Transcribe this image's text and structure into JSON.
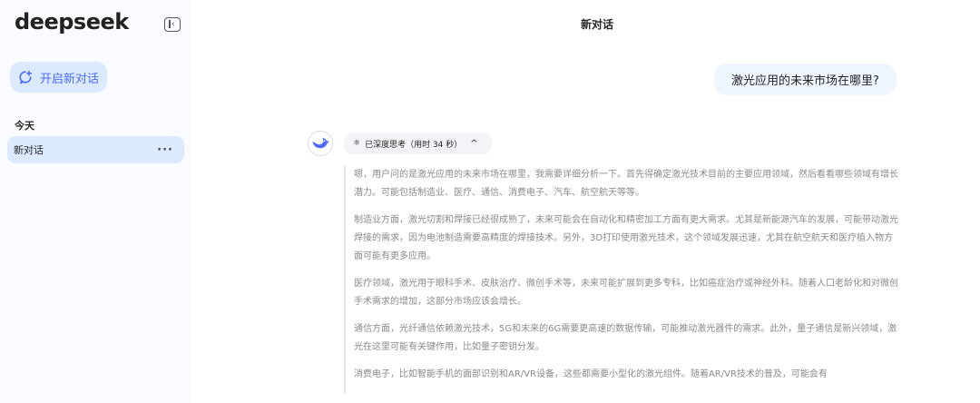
{
  "sidebar": {
    "logo": "deepseek",
    "new_chat_label": "开启新对话",
    "section_today": "今天",
    "history": [
      {
        "title": "新对话",
        "more": "···"
      }
    ]
  },
  "main": {
    "title": "新对话",
    "user_message": "激光应用的未来市场在哪里?",
    "thinking_toggle": {
      "icon": "atom-icon",
      "label": "已深度思考（用时 34 秒）",
      "chevron": "^"
    },
    "reasoning": [
      "嗯，用户问的是激光应用的未来市场在哪里，我需要详细分析一下。首先得确定激光技术目前的主要应用领域，然后看看哪些领域有增长潜力。可能包括制造业、医疗、通信、消费电子、汽车、航空航天等等。",
      "制造业方面，激光切割和焊接已经很成熟了，未来可能会在自动化和精密加工方面有更大需求。尤其是新能源汽车的发展，可能带动激光焊接的需求，因为电池制造需要高精度的焊接技术。另外，3D打印使用激光技术，这个领域发展迅速，尤其在航空航天和医疗植入物方面可能有更多应用。",
      "医疗领域，激光用于眼科手术、皮肤治疗、微创手术等，未来可能扩展到更多专科，比如癌症治疗或神经外科。随着人口老龄化和对微创手术需求的增加，这部分市场应该会增长。",
      "通信方面，光纤通信依赖激光技术，5G和未来的6G需要更高速的数据传输，可能推动激光器件的需求。此外，量子通信是新兴领域，激光在这里可能有关键作用，比如量子密钥分发。",
      "消费电子，比如智能手机的面部识别和AR/VR设备，这些都需要小型化的激光组件。随着AR/VR技术的普及，可能会有"
    ]
  },
  "colors": {
    "accent": "#4d6bfe",
    "sidebar_bg": "#f9fbff",
    "selected_bg": "#dbeafe",
    "user_bubble_bg": "#eff6ff",
    "reasoning_text": "#8b8b8b"
  }
}
